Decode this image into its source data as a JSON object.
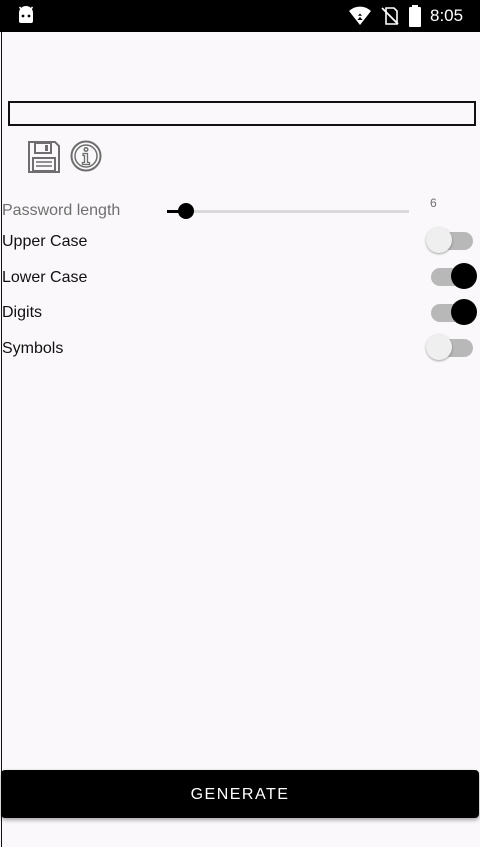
{
  "status_bar": {
    "time": "8:05",
    "icons": [
      "android-icon",
      "wifi-icon",
      "no-sim-icon",
      "battery-icon"
    ]
  },
  "password_output": {
    "value": ""
  },
  "toolbar": {
    "icons": [
      "save-icon",
      "info-icon"
    ]
  },
  "settings": {
    "password_length": {
      "label": "Password length",
      "value": "6",
      "fraction": 0.08
    },
    "upper_case": {
      "label": "Upper Case",
      "checked": false
    },
    "lower_case": {
      "label": "Lower Case",
      "checked": true
    },
    "digits": {
      "label": "Digits",
      "checked": true
    },
    "symbols": {
      "label": "Symbols",
      "checked": false
    }
  },
  "generate_button": {
    "label": "GENERATE"
  },
  "colors": {
    "accent": "#000000",
    "background": "#faf8fa",
    "switch_track": "#b8b8b8",
    "muted_text": "#6f6f6f"
  }
}
